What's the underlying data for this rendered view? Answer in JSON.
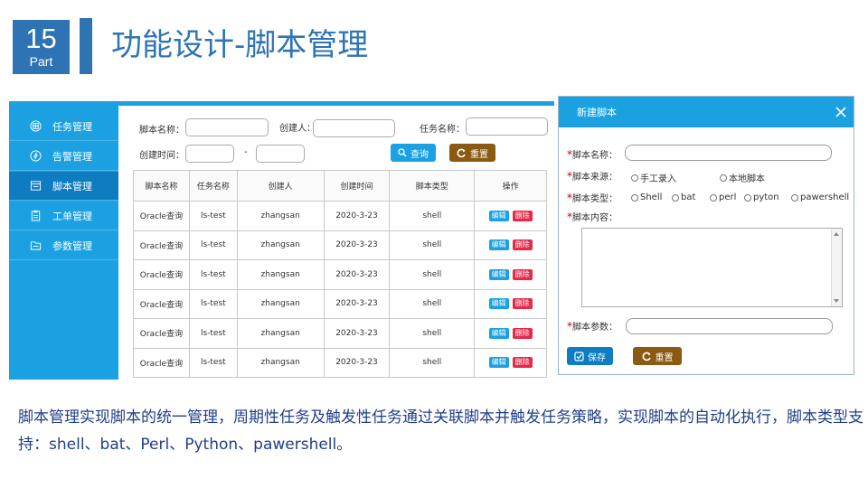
{
  "header": {
    "part_number": "15",
    "part_label": "Part",
    "title": "功能设计-脚本管理"
  },
  "sidebar": {
    "items": [
      {
        "label": "任务管理",
        "icon": "grid-icon"
      },
      {
        "label": "告警管理",
        "icon": "alarm-icon"
      },
      {
        "label": "脚本管理",
        "icon": "script-icon",
        "active": true
      },
      {
        "label": "工单管理",
        "icon": "clipboard-icon"
      },
      {
        "label": "参数管理",
        "icon": "folder-icon"
      }
    ]
  },
  "filters": {
    "script_name_label": "脚本名称：",
    "creator_label": "创建人：",
    "task_name_label": "任务名称：",
    "created_time_label": "创建时间：",
    "range_separator": "-",
    "query_button": "查询",
    "reset_button": "重置"
  },
  "table": {
    "headers": [
      "脚本名称",
      "任务名称",
      "创建人",
      "创建时间",
      "脚本类型",
      "操作"
    ],
    "rows": [
      [
        "Oracle查询",
        "ls-test",
        "zhangsan",
        "2020-3-23",
        "shell"
      ],
      [
        "Oracle查询",
        "ls-test",
        "zhangsan",
        "2020-3-23",
        "shell"
      ],
      [
        "Oracle查询",
        "ls-test",
        "zhangsan",
        "2020-3-23",
        "shell"
      ],
      [
        "Oracle查询",
        "ls-test",
        "zhangsan",
        "2020-3-23",
        "shell"
      ],
      [
        "Oracle查询",
        "ls-test",
        "zhangsan",
        "2020-3-23",
        "shell"
      ],
      [
        "Oracle查询",
        "ls-test",
        "zhangsan",
        "2020-3-23",
        "shell"
      ]
    ],
    "edit_label": "编辑",
    "delete_label": "删除"
  },
  "dialog": {
    "title": "新建脚本",
    "name_label": "脚本名称：",
    "source_label": "脚本来源：",
    "source_options": [
      "手工录入",
      "本地脚本"
    ],
    "type_label": "脚本类型：",
    "type_options": [
      "Shell",
      "bat",
      "perl",
      "pyton",
      "pawershell"
    ],
    "content_label": "脚本内容：",
    "params_label": "脚本参数：",
    "save_button": "保存",
    "reset_button": "重置"
  },
  "description": "脚本管理实现脚本的统一管理，周期性任务及触发性任务通过关联脚本并触发任务策略，实现脚本的自动化执行，脚本类型支持：shell、bat、Perl、Python、pawershell。",
  "colors": {
    "brand": "#2e74b5",
    "accent": "#1ba1e2",
    "sidebar_active": "#0e7cc0",
    "reset_brown": "#8a5a12",
    "delete_red": "#e5294a",
    "required_red": "#c00000",
    "description_text": "#1f3e8a"
  }
}
